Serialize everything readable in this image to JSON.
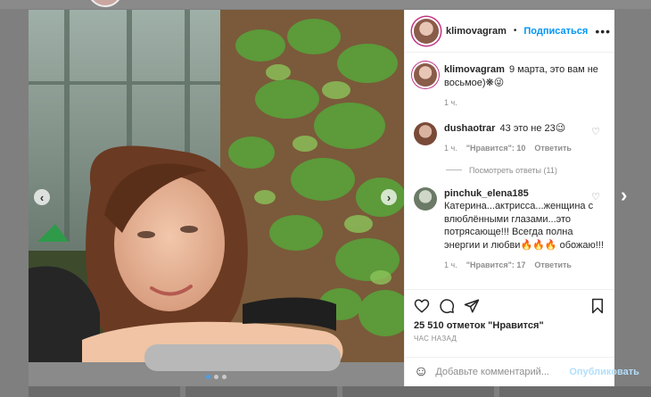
{
  "post": {
    "author": "klimovagram",
    "separator": "•",
    "follow_label": "Подписаться",
    "more_icon": "more-horizontal-icon",
    "caption_user": "klimovagram",
    "caption_text": "9 марта, это вам не восьмое)❋😜",
    "caption_time": "1 ч."
  },
  "comments": [
    {
      "user": "dushaotrar",
      "text": "43 это не 23😉",
      "time": "1 ч.",
      "likes": "\"Нравится\": 10",
      "reply": "Ответить",
      "view_replies": "Посмотреть ответы (11)"
    },
    {
      "user": "pinchuk_elena185",
      "text": "Катерина...актрисса...женщина с влюблёнными глазами...это потрясающе!!! Всегда полна энергии и любви🔥🔥🔥 обожаю!!!",
      "time": "1 ч.",
      "likes": "\"Нравится\": 17",
      "reply": "Ответить"
    }
  ],
  "actions": {
    "likes_count": "25 510 отметок \"Нравится\"",
    "posted_ago": "ЧАС НАЗАД"
  },
  "composer": {
    "placeholder": "Добавьте комментарий...",
    "post_label": "Опубликовать"
  },
  "carousel": {
    "prev_icon": "‹",
    "next_icon": "›",
    "slides": 3,
    "active_slide": 0,
    "outer_next_icon": "›"
  },
  "colors": {
    "accent": "#0095f6",
    "muted": "#8e8e8e",
    "disabled_accent": "#b2dffc"
  }
}
